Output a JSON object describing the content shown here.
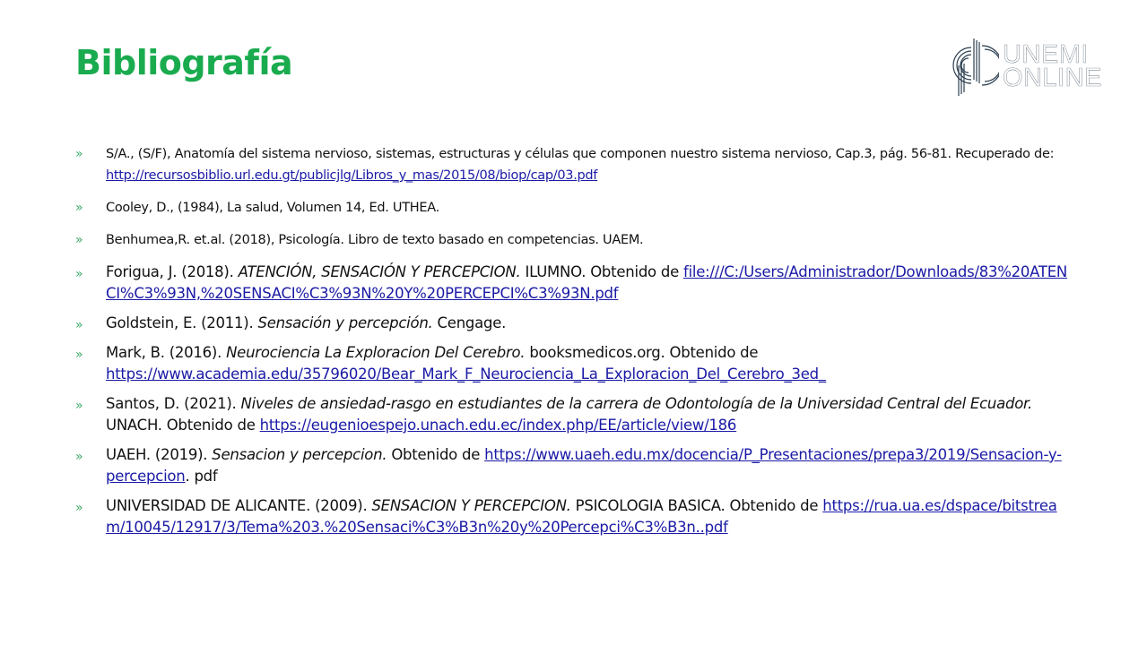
{
  "slide": {
    "title": "Bibliografía",
    "logo": {
      "line1": "UNEMI",
      "line2": "ONLINE"
    },
    "bullet_glyph": "»",
    "colors": {
      "title": "#1aab4f",
      "link": "#1a1aa6",
      "bullet": "#3aa86a",
      "logo": "#2c3e50"
    }
  },
  "references": [
    {
      "pre": "S/A., (S/F), Anatomía del sistema nervioso, sistemas, estructuras y células que componen nuestro sistema nervioso, Cap.3, pág. 56-81. Recuperado de: ",
      "italic": "",
      "mid": "",
      "link": "http://recursosbiblio.url.edu.gt/publicjlg/Libros_y_mas/2015/08/biop/cap/03.pdf",
      "post": ""
    },
    {
      "pre": "Cooley, D., (1984), La salud, Volumen 14, Ed. UTHEA.",
      "italic": "",
      "mid": "",
      "link": "",
      "post": ""
    },
    {
      "pre": "Benhumea,R. et.al. (2018), Psicología. Libro de texto basado en competencias. UAEM.",
      "italic": "",
      "mid": "",
      "link": "",
      "post": ""
    },
    {
      "pre": "Forigua, J. (2018). ",
      "italic": "ATENCIÓN, SENSACIÓN Y PERCEPCION.",
      "mid": " ILUMNO. Obtenido de ",
      "link": "file:///C:/Users/Administrador/Downloads/83%20ATENCI%C3%93N,%20SENSACI%C3%93N%20Y%20PERCEPCI%C3%93N.pdf",
      "post": ""
    },
    {
      "pre": "Goldstein, E. (2011). ",
      "italic": "Sensación y percepción.",
      "mid": " Cengage.",
      "link": "",
      "post": ""
    },
    {
      "pre": "Mark, B. (2016). ",
      "italic": "Neurociencia La Exploracion Del Cerebro.",
      "mid": " booksmedicos.org. Obtenido de ",
      "link": "https://www.academia.edu/35796020/Bear_Mark_F_Neurociencia_La_Exploracion_Del_Cerebro_3ed_",
      "post": ""
    },
    {
      "pre": "Santos, D. (2021). ",
      "italic": "Niveles de ansiedad-rasgo en estudiantes de la carrera de Odontología de la Universidad Central del Ecuador.",
      "mid": " UNACH. Obtenido de ",
      "link": "https://eugenioespejo.unach.edu.ec/index.php/EE/article/view/186",
      "post": ""
    },
    {
      "pre": "UAEH. (2019). ",
      "italic": "Sensacion y percepcion.",
      "mid": " Obtenido de ",
      "link": "https://www.uaeh.edu.mx/docencia/P_Presentaciones/prepa3/2019/Sensacion-y-percepcion",
      "post": ". pdf"
    },
    {
      "pre": "UNIVERSIDAD DE ALICANTE. (2009). ",
      "italic": "SENSACION Y PERCEPCION.",
      "mid": " PSICOLOGIA BASICA. Obtenido de ",
      "link": "https://rua.ua.es/dspace/bitstream/10045/12917/3/Tema%203.%20Sensaci%C3%B3n%20y%20Percepci%C3%B3n..pdf",
      "post": ""
    }
  ]
}
